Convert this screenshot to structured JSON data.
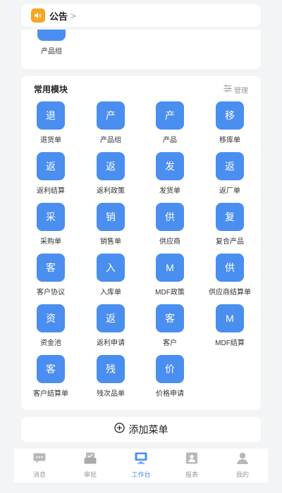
{
  "notice": {
    "label": "公告",
    "chevron": ">"
  },
  "previous_section": {
    "item_label": "产品组"
  },
  "modules": {
    "title": "常用模块",
    "manage_label": "管理",
    "items": [
      {
        "glyph": "退",
        "label": "退货单"
      },
      {
        "glyph": "产",
        "label": "产品组"
      },
      {
        "glyph": "产",
        "label": "产品"
      },
      {
        "glyph": "移",
        "label": "移库单"
      },
      {
        "glyph": "返",
        "label": "返利结算"
      },
      {
        "glyph": "返",
        "label": "返利政策"
      },
      {
        "glyph": "发",
        "label": "发货单"
      },
      {
        "glyph": "返",
        "label": "返厂单"
      },
      {
        "glyph": "采",
        "label": "采购单"
      },
      {
        "glyph": "销",
        "label": "销售单"
      },
      {
        "glyph": "供",
        "label": "供应商"
      },
      {
        "glyph": "复",
        "label": "复合产品"
      },
      {
        "glyph": "客",
        "label": "客户协议"
      },
      {
        "glyph": "入",
        "label": "入库单"
      },
      {
        "glyph": "M",
        "label": "MDF政策"
      },
      {
        "glyph": "供",
        "label": "供应商结算单"
      },
      {
        "glyph": "资",
        "label": "资金池"
      },
      {
        "glyph": "返",
        "label": "返利申请"
      },
      {
        "glyph": "客",
        "label": "客户"
      },
      {
        "glyph": "M",
        "label": "MDF结算"
      },
      {
        "glyph": "客",
        "label": "客户结算单"
      },
      {
        "glyph": "残",
        "label": "残次品单"
      },
      {
        "glyph": "价",
        "label": "价格申请"
      }
    ]
  },
  "add_menu": {
    "label": "添加菜单"
  },
  "tabbar": {
    "tabs": [
      {
        "label": "消息",
        "icon": "message-icon",
        "active": false
      },
      {
        "label": "审批",
        "icon": "approval-icon",
        "active": false
      },
      {
        "label": "工作台",
        "icon": "workbench-icon",
        "active": true
      },
      {
        "label": "报表",
        "icon": "report-icon",
        "active": false
      },
      {
        "label": "我的",
        "icon": "profile-icon",
        "active": false
      }
    ]
  },
  "colors": {
    "accent": "#4a8ef0",
    "notice_icon": "#f5a623",
    "background": "#f3f4f6",
    "inactive_tab": "#999999"
  }
}
